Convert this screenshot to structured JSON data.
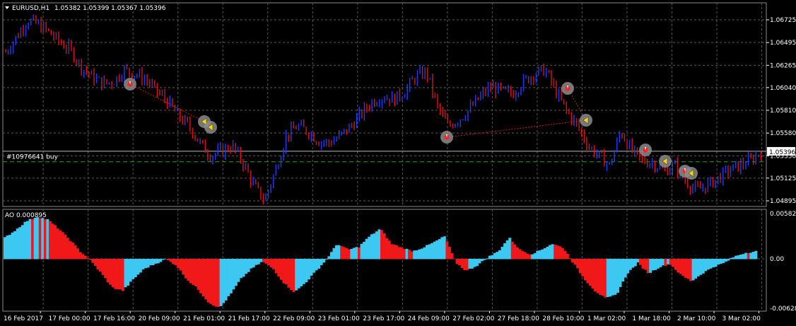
{
  "header": {
    "symbol_label": "EURUSD,H1",
    "ohlc_label": "1.05382 1.05399 1.05367 1.05396"
  },
  "position_label": "#10976641 buy",
  "current_price_label": "1.05396",
  "indicator": {
    "label": "AO 0.000895"
  },
  "colors": {
    "background": "#000000",
    "grid": "#5a5a5a",
    "bull_bar": "#1e3cff",
    "bear_bar": "#e01010",
    "ao_up": "#3cc8f0",
    "ao_down": "#f01818",
    "position_line": "#2aa02a",
    "trade_line": "#c81e1e"
  },
  "chart_data": [
    {
      "type": "candlestick",
      "title": "EURUSD,H1",
      "y_ticks": [
        "1.06725",
        "1.06495",
        "1.06265",
        "1.06040",
        "1.05810",
        "1.05580",
        "1.05350",
        "1.05125",
        "1.04895"
      ],
      "ylim": [
        1.04895,
        1.06725
      ],
      "current_price": 1.05396,
      "position_price": 1.0529,
      "x_ticks": [
        "16 Feb 2017",
        "17 Feb 00:00",
        "17 Feb 16:00",
        "20 Feb 09:00",
        "21 Feb 01:00",
        "21 Feb 17:00",
        "22 Feb 09:00",
        "23 Feb 01:00",
        "23 Feb 17:00",
        "24 Feb 09:00",
        "27 Feb 02:00",
        "27 Feb 18:00",
        "28 Feb 10:00",
        "1 Mar 02:00",
        "1 Mar 18:00",
        "2 Mar 10:00",
        "3 Mar 02:00"
      ],
      "close_path": [
        1.064,
        1.0655,
        1.0672,
        1.0668,
        1.066,
        1.065,
        1.0642,
        1.0625,
        1.0615,
        1.0608,
        1.061,
        1.0622,
        1.0618,
        1.0612,
        1.06,
        1.059,
        1.0575,
        1.0565,
        1.0548,
        1.0535,
        1.054,
        1.0545,
        1.0528,
        1.0505,
        1.049,
        1.052,
        1.0555,
        1.0565,
        1.056,
        1.055,
        1.0548,
        1.0555,
        1.0565,
        1.0578,
        1.059,
        1.0595,
        1.0592,
        1.06,
        1.0615,
        1.062,
        1.0585,
        1.0565,
        1.0572,
        1.0582,
        1.0595,
        1.0605,
        1.06,
        1.0598,
        1.061,
        1.0618,
        1.0622,
        1.06,
        1.058,
        1.0565,
        1.0545,
        1.0535,
        1.0525,
        1.056,
        1.054,
        1.053,
        1.0528,
        1.052,
        1.0525,
        1.051,
        1.05,
        1.0505,
        1.0512,
        1.052,
        1.0525,
        1.053,
        1.054
      ],
      "trades": [
        {
          "entry": 1.0608,
          "exit": 1.0575
        },
        {
          "entry": 1.056,
          "exit": 1.0575
        },
        {
          "entry": 1.0605,
          "exit": 1.057
        }
      ]
    },
    {
      "type": "histogram",
      "title": "AO 0.000895",
      "y_ticks": [
        "0.00582",
        "0.00",
        "-0.006280"
      ],
      "ylim": [
        -0.00628,
        0.00582
      ],
      "values": [
        0.0028,
        0.0038,
        0.005,
        0.0056,
        0.0052,
        0.004,
        0.0026,
        0.001,
        -0.0002,
        -0.0018,
        -0.0036,
        -0.004,
        -0.0025,
        -0.0012,
        -0.0006,
        0.0,
        -0.0008,
        -0.0026,
        -0.0038,
        -0.0055,
        -0.0062,
        -0.0045,
        -0.0025,
        -0.0012,
        -0.0003,
        -0.0012,
        -0.003,
        -0.0042,
        -0.003,
        -0.0015,
        0.0,
        0.002,
        0.0012,
        0.0016,
        0.003,
        0.004,
        0.002,
        0.0015,
        0.001,
        0.0015,
        0.0022,
        0.003,
        -0.0004,
        -0.0015,
        -0.0008,
        0.0002,
        0.001,
        0.0028,
        0.0012,
        0.0006,
        0.0012,
        0.002,
        0.0015,
        -0.0005,
        -0.0025,
        -0.004,
        -0.005,
        -0.0045,
        -0.0018,
        -0.0005,
        -0.0018,
        -0.001,
        -0.0006,
        -0.002,
        -0.0028,
        -0.0018,
        -0.001,
        -0.0005,
        0.0003,
        0.0008,
        0.001
      ]
    }
  ]
}
